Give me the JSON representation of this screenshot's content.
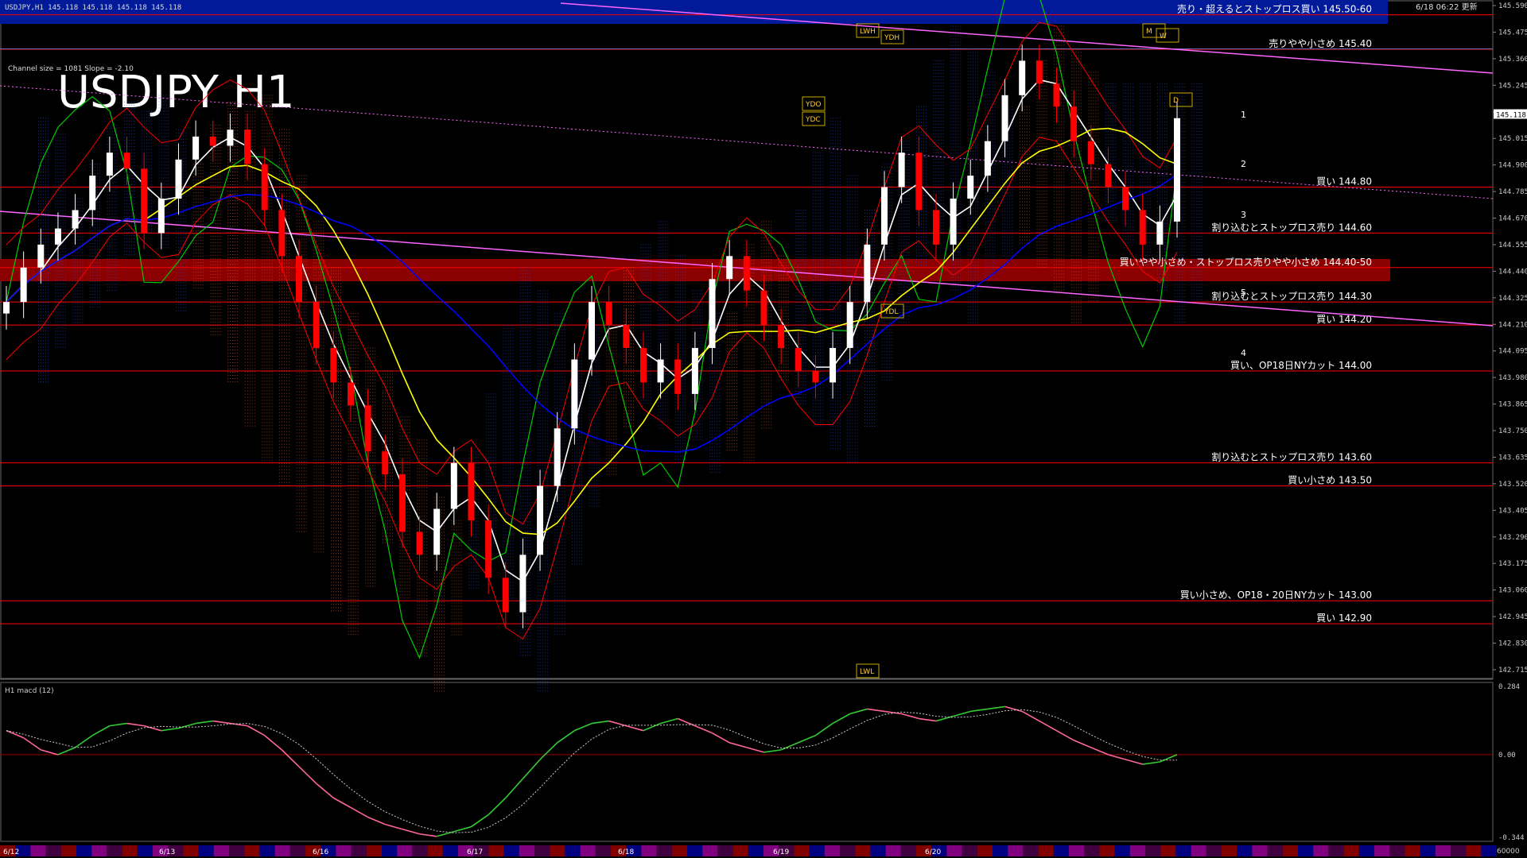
{
  "header": {
    "symbol_line": "USDJPY,H1  145.118 145.118 145.118 145.118",
    "updated": "6/18 06:22 更新",
    "channel_info": "Channel size = 1081 Slope = -2.10",
    "title": "USDJPY H1"
  },
  "colors": {
    "bg": "#000000",
    "bull": "#ffffff",
    "bear": "#ff0000",
    "ma_fast": "#ffffff",
    "ma_mid": "#ffff00",
    "ma_slow": "#0000ff",
    "bollinger": "#ff0000",
    "chikou": "#00cc00",
    "trend": "#ff66ff",
    "level": "#ff0000",
    "macd_up": "#33cc33",
    "macd_down": "#ff6699",
    "banner": "#001a99",
    "zone": "#8b0000"
  },
  "chart_data": {
    "type": "candlestick",
    "title": "USDJPY H1",
    "ylim": [
      142.7,
      145.59
    ],
    "y_ticks": [
      "145.590",
      "145.475",
      "145.360",
      "145.245",
      "145.130",
      "145.015",
      "144.900",
      "144.785",
      "144.670",
      "144.555",
      "144.440",
      "144.325",
      "144.210",
      "144.095",
      "143.980",
      "143.865",
      "143.750",
      "143.635",
      "143.520",
      "143.405",
      "143.290",
      "143.175",
      "143.060",
      "142.945",
      "142.830",
      "142.715"
    ],
    "current_price": "145.118",
    "dates": [
      "6/12",
      "6/13",
      "6/16",
      "6/17",
      "6/18",
      "6/19",
      "6/20"
    ],
    "close": [
      144.3,
      144.45,
      144.55,
      144.62,
      144.7,
      144.85,
      144.95,
      144.88,
      144.6,
      144.75,
      144.92,
      145.02,
      144.98,
      145.05,
      144.9,
      144.7,
      144.5,
      144.3,
      144.1,
      143.95,
      143.85,
      143.65,
      143.55,
      143.3,
      143.2,
      143.4,
      143.6,
      143.35,
      143.1,
      142.95,
      143.2,
      143.5,
      143.75,
      144.05,
      144.3,
      144.2,
      144.1,
      143.95,
      144.05,
      143.9,
      144.1,
      144.4,
      144.5,
      144.35,
      144.2,
      144.1,
      144.0,
      143.95,
      144.1,
      144.3,
      144.55,
      144.8,
      144.95,
      144.7,
      144.55,
      144.75,
      144.85,
      145.0,
      145.2,
      145.35,
      145.25,
      145.15,
      145.0,
      144.9,
      144.8,
      144.7,
      144.55,
      144.65,
      145.1
    ],
    "levels": [
      {
        "label": "売り・超えるとストップロス買い 145.50-60",
        "price": 145.55
      },
      {
        "label": "売りやや小さめ 145.40",
        "price": 145.4
      },
      {
        "label": "買い 144.80",
        "price": 144.8
      },
      {
        "label": "割り込むとストップロス売り 144.60",
        "price": 144.6
      },
      {
        "label": "買いやや小さめ・ストップロス売りやや小さめ 144.40-50",
        "price": 144.45
      },
      {
        "label": "割り込むとストップロス売り 144.30",
        "price": 144.3
      },
      {
        "label": "買い 144.20",
        "price": 144.2
      },
      {
        "label": "買い、OP18日NYカット 144.00",
        "price": 144.0
      },
      {
        "label": "割り込むとストップロス売り 143.60",
        "price": 143.6
      },
      {
        "label": "買い小さめ 143.50",
        "price": 143.5
      },
      {
        "label": "買い小さめ、OP18・20日NYカット 143.00",
        "price": 143.0
      },
      {
        "label": "買い 142.90",
        "price": 142.9
      }
    ],
    "markers": [
      "LWH",
      "YDH",
      "YDO",
      "YDC",
      "YDL",
      "LWL",
      "M",
      "W",
      "D"
    ],
    "channel_numbers": [
      "1",
      "2",
      "3",
      "4",
      "5"
    ],
    "macd": {
      "label": "H1  macd (12)",
      "ylim": [
        -0.344,
        0.284
      ],
      "y_ticks": [
        "0.284",
        "0.00",
        "-0.344"
      ],
      "values": [
        0.1,
        0.07,
        0.02,
        0.0,
        0.03,
        0.08,
        0.12,
        0.13,
        0.12,
        0.1,
        0.11,
        0.13,
        0.14,
        0.13,
        0.12,
        0.08,
        0.02,
        -0.05,
        -0.12,
        -0.18,
        -0.22,
        -0.26,
        -0.29,
        -0.31,
        -0.33,
        -0.34,
        -0.32,
        -0.3,
        -0.25,
        -0.18,
        -0.1,
        -0.02,
        0.05,
        0.1,
        0.13,
        0.14,
        0.12,
        0.1,
        0.13,
        0.15,
        0.12,
        0.09,
        0.05,
        0.03,
        0.01,
        0.02,
        0.05,
        0.08,
        0.13,
        0.17,
        0.19,
        0.18,
        0.17,
        0.15,
        0.14,
        0.16,
        0.18,
        0.19,
        0.2,
        0.18,
        0.14,
        0.1,
        0.06,
        0.03,
        0.0,
        -0.02,
        -0.04,
        -0.03,
        0.0
      ]
    },
    "bottom_label": "60000"
  }
}
